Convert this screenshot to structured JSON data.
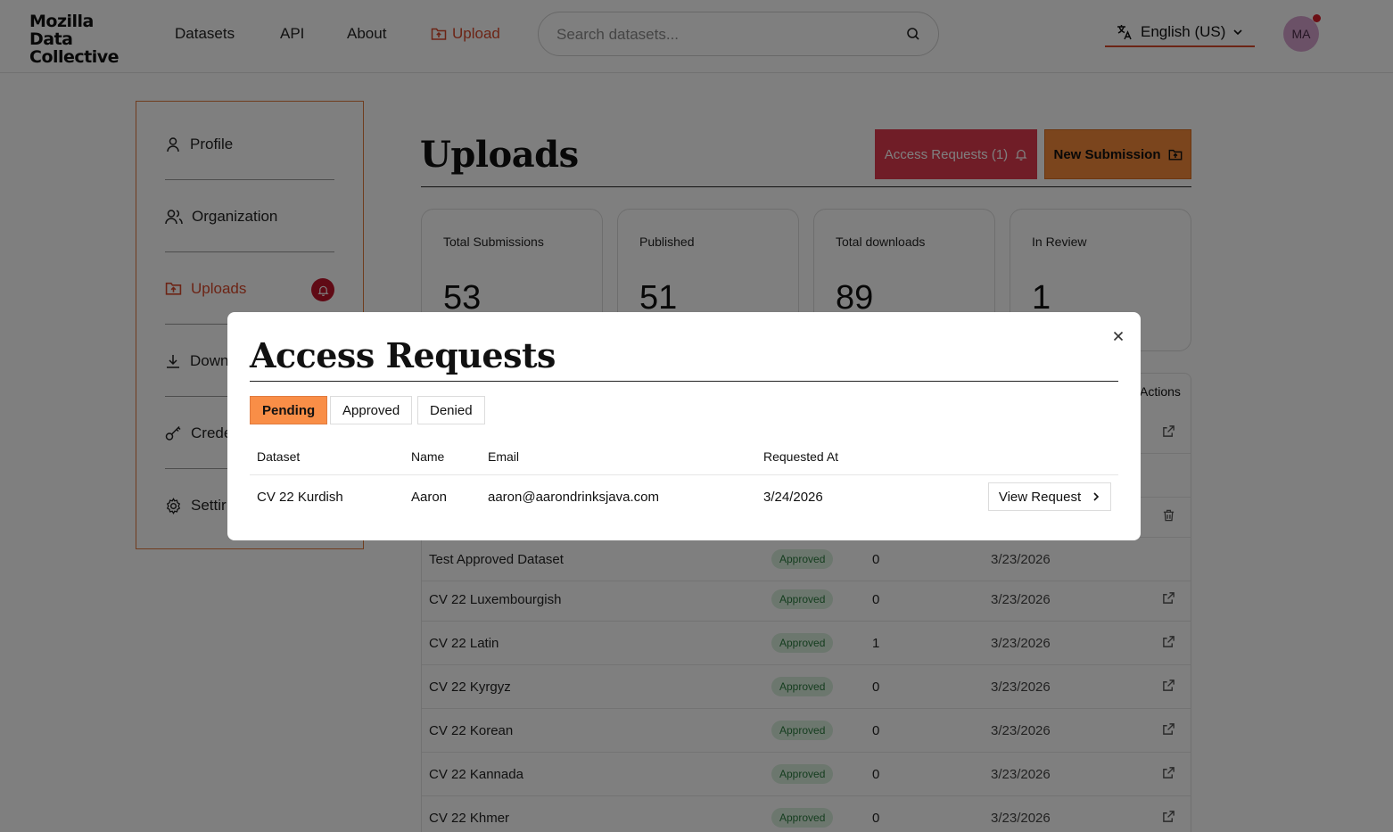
{
  "header": {
    "logo_lines": [
      "Mozilla",
      "Data",
      "Collective"
    ],
    "nav": {
      "datasets": "Datasets",
      "api": "API",
      "about": "About",
      "upload": "Upload"
    },
    "search_placeholder": "Search datasets...",
    "language": "English (US)",
    "avatar_initials": "MA"
  },
  "sidebar": {
    "items": [
      {
        "label": "Profile",
        "icon": "user-icon"
      },
      {
        "label": "Organization",
        "icon": "users-icon"
      },
      {
        "label": "Uploads",
        "icon": "upload-folder-icon",
        "active": true
      },
      {
        "label": "Down",
        "icon": "download-icon"
      },
      {
        "label": "Crede",
        "icon": "key-icon"
      },
      {
        "label": "Settir",
        "icon": "gear-icon"
      }
    ]
  },
  "main": {
    "title": "Uploads",
    "access_requests_label": "Access Requests (1)",
    "new_submission_label": "New Submission",
    "stats": [
      {
        "label": "Total Submissions",
        "value": "53"
      },
      {
        "label": "Published",
        "value": "51"
      },
      {
        "label": "Total downloads",
        "value": "89"
      },
      {
        "label": "In Review",
        "value": "1"
      }
    ],
    "table": {
      "actions_header": "Actions",
      "rows": [
        {
          "name": "Test Approved Dataset",
          "status": "Approved",
          "downloads": "0",
          "date": "3/23/2026"
        },
        {
          "name": "CV 22 Luxembourgish",
          "status": "Approved",
          "downloads": "0",
          "date": "3/23/2026"
        },
        {
          "name": "CV 22 Latin",
          "status": "Approved",
          "downloads": "1",
          "date": "3/23/2026"
        },
        {
          "name": "CV 22 Kyrgyz",
          "status": "Approved",
          "downloads": "0",
          "date": "3/23/2026"
        },
        {
          "name": "CV 22 Korean",
          "status": "Approved",
          "downloads": "0",
          "date": "3/23/2026"
        },
        {
          "name": "CV 22 Kannada",
          "status": "Approved",
          "downloads": "0",
          "date": "3/23/2026"
        },
        {
          "name": "CV 22 Khmer",
          "status": "Approved",
          "downloads": "0",
          "date": "3/23/2026"
        }
      ]
    }
  },
  "modal": {
    "title": "Access Requests",
    "tabs": [
      "Pending",
      "Approved",
      "Denied"
    ],
    "columns": [
      "Dataset",
      "Name",
      "Email",
      "Requested At"
    ],
    "request": {
      "dataset": "CV 22 Kurdish",
      "name": "Aaron",
      "email": "aaron@aarondrinksjava.com",
      "requested_at": "3/24/2026"
    },
    "view_label": "View Request"
  },
  "colors": {
    "accent_orange": "#f98e47",
    "accent_red": "#e13a4f",
    "link_red": "#d9482b",
    "approved_bg": "#d8efdc",
    "approved_fg": "#2a7a3e"
  }
}
